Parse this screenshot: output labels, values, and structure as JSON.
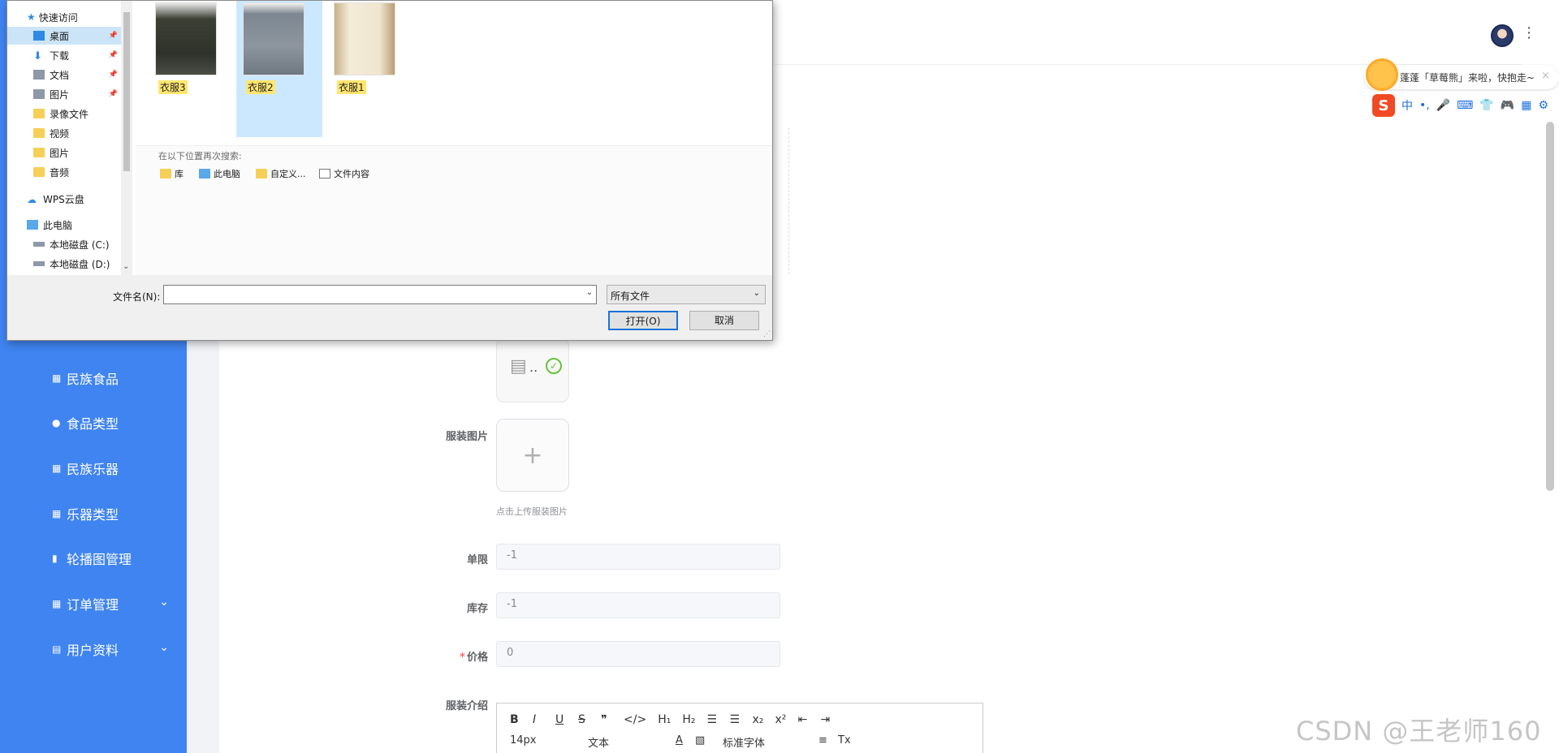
{
  "sidebar": {
    "items": [
      {
        "label": "民族食品",
        "icon": "grid-icon"
      },
      {
        "label": "食品类型",
        "icon": "user-icon"
      },
      {
        "label": "民族乐器",
        "icon": "grid-icon"
      },
      {
        "label": "乐器类型",
        "icon": "grid-icon"
      },
      {
        "label": "轮播图管理",
        "icon": "clipboard-icon"
      },
      {
        "label": "订单管理",
        "icon": "grid-icon",
        "chevron": "⌄"
      },
      {
        "label": "用户资料",
        "icon": "calendar-icon",
        "chevron": "⌄"
      }
    ]
  },
  "sogou": {
    "bubble_text": "蓬蓬「草莓熊」来啦，快抱走~",
    "close": "×",
    "logo": "S",
    "toolbar": [
      "中",
      "•,",
      "🎤",
      "⌨",
      "👕",
      "🎮",
      "▦",
      "⚙"
    ]
  },
  "form": {
    "image_label": "服装图片",
    "upload_plus": "+",
    "upload_hint": "点击上传服装图片",
    "file_dots": "..",
    "limit_label": "单限",
    "limit_value": "-1",
    "stock_label": "库存",
    "stock_value": "-1",
    "price_required": "*",
    "price_label": "价格",
    "price_value": "0",
    "intro_label": "服装介绍"
  },
  "editor": {
    "row1": [
      "B",
      "I",
      "U",
      "S",
      "❞",
      "</>",
      "H₁",
      "H₂",
      "☰",
      "☰",
      "x₂",
      "x²",
      "⇤",
      "⇥"
    ],
    "font_size": "14px",
    "block_type": "文本",
    "font_color": "A",
    "font_family": "标准字体",
    "align": "≡",
    "clear": "Tx"
  },
  "watermark": "CSDN @王老师160",
  "dialog": {
    "nav": {
      "quick_access": "快速访问",
      "items": [
        {
          "label": "桌面",
          "pinned": true,
          "selected": true
        },
        {
          "label": "下载",
          "pinned": true
        },
        {
          "label": "文档",
          "pinned": true
        },
        {
          "label": "图片",
          "pinned": true
        },
        {
          "label": "录像文件"
        },
        {
          "label": "视频"
        },
        {
          "label": "图片"
        },
        {
          "label": "音频"
        }
      ],
      "wps": "WPS云盘",
      "this_pc": "此电脑",
      "disk_c": "本地磁盘 (C:)",
      "disk_d": "本地磁盘 (D:)"
    },
    "files": [
      {
        "name": "衣服3"
      },
      {
        "name": "衣服2",
        "selected": true
      },
      {
        "name": "衣服1"
      }
    ],
    "search_again": {
      "header": "在以下位置再次搜索:",
      "links": [
        "库",
        "此电脑",
        "自定义...",
        "文件内容"
      ]
    },
    "filename_label": "文件名(N):",
    "filename_value": "",
    "filetype": "所有文件",
    "open_button": "打开(O)",
    "cancel_button": "取消"
  },
  "colors": {
    "sidebar": "#3f84f0",
    "highlight": "#ffe66e",
    "selection": "#cce8ff"
  }
}
